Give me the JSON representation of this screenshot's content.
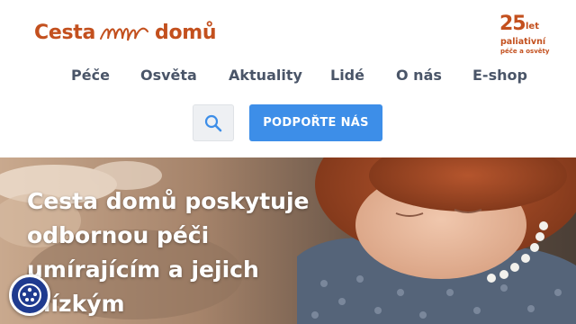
{
  "logo": {
    "text_left": "Cesta",
    "text_right": "domů",
    "color": "#c3501e"
  },
  "badge": {
    "number": "25",
    "unit": "let",
    "line1": "paliativní",
    "line2": "péče a osvěty"
  },
  "nav": {
    "items": [
      {
        "label": "Péče"
      },
      {
        "label": "Osvěta"
      },
      {
        "label": "Aktuality"
      },
      {
        "label": "Lidé"
      },
      {
        "label": "O nás"
      },
      {
        "label": "E-shop"
      }
    ]
  },
  "search": {
    "icon": "search-icon"
  },
  "support_button": {
    "label": "PODPOŘTE NÁS",
    "color": "#3d8ee8"
  },
  "hero": {
    "title": "Cesta domů poskytuje odbornou péči umírajícím a jejich blízkým"
  },
  "accessibility": {
    "icon": "accessibility-icon",
    "color": "#1f3b8f"
  }
}
